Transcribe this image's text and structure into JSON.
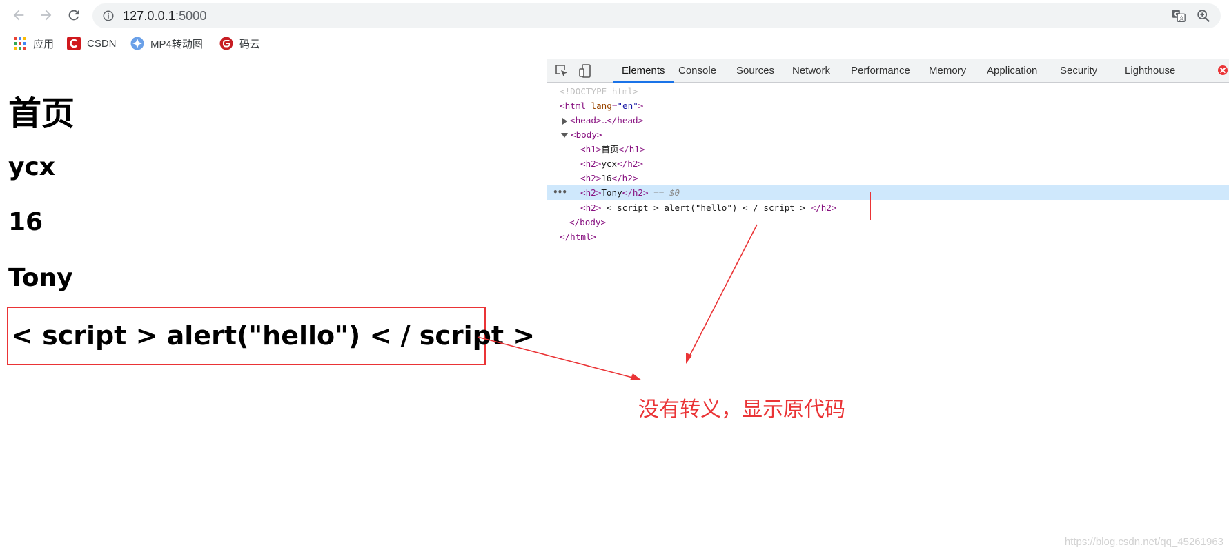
{
  "browser": {
    "url_host": "127.0.0.1",
    "url_port": ":5000",
    "bookmarks": [
      {
        "label": "应用",
        "icon": "apps-grid-icon"
      },
      {
        "label": "CSDN",
        "icon": "csdn-logo-icon"
      },
      {
        "label": "MP4转动图",
        "icon": "mp4-converter-icon"
      },
      {
        "label": "码云",
        "icon": "gitee-logo-icon"
      }
    ]
  },
  "page": {
    "h1": "首页",
    "h2_items": [
      "ycx",
      "16",
      "Tony",
      "< script > alert(\"hello\") < / script >"
    ]
  },
  "devtools": {
    "tabs": [
      "Elements",
      "Console",
      "Sources",
      "Network",
      "Performance",
      "Memory",
      "Application",
      "Security",
      "Lighthouse"
    ],
    "active_tab": "Elements",
    "dom": {
      "doctype": "<!DOCTYPE html>",
      "html_open": "<html",
      "html_lang_attr": "lang",
      "html_lang_value": "\"en\"",
      "html_open_end": ">",
      "head_collapsed": "<head>…</head>",
      "body_open": "<body>",
      "h1_open": "<h1>",
      "h1_text": "首页",
      "h1_close": "</h1>",
      "h2_open": "<h2>",
      "h2_close": "</h2>",
      "h2_texts": [
        "ycx",
        "16",
        "Tony",
        " < script > alert(\"hello\") < / script > "
      ],
      "selected_marker": " == $0",
      "body_close": "</body>",
      "html_close": "</html>",
      "gutter_dots": "•••"
    }
  },
  "annotation": {
    "text": "没有转义，显示原代码",
    "color": "#ea3436"
  },
  "watermark": "https://blog.csdn.net/qq_45261963"
}
